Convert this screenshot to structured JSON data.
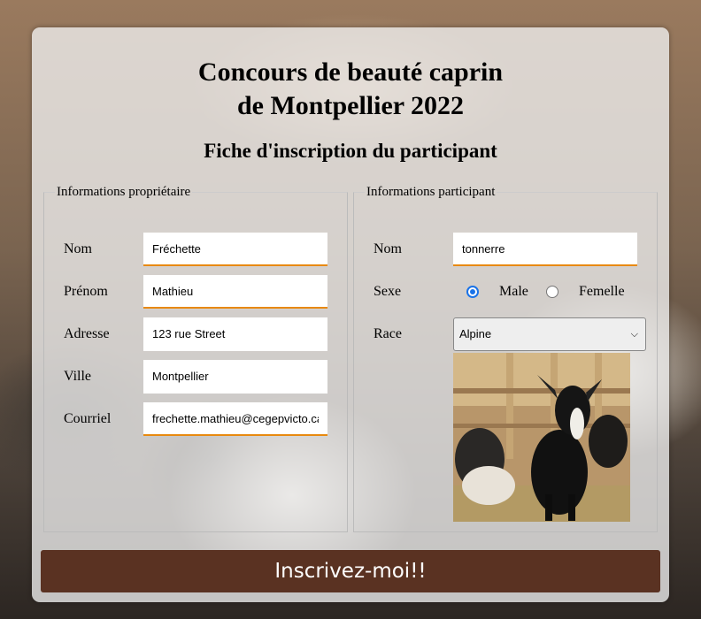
{
  "header": {
    "title_line1": "Concours de beauté caprin",
    "title_line2": "de Montpellier 2022",
    "subtitle": "Fiche d'inscription du participant"
  },
  "owner": {
    "legend": "Informations propriétaire",
    "fields": [
      {
        "label": "Nom",
        "value": "Fréchette"
      },
      {
        "label": "Prénom",
        "value": "Mathieu"
      },
      {
        "label": "Adresse",
        "value": "123 rue Street"
      },
      {
        "label": "Ville",
        "value": "Montpellier"
      },
      {
        "label": "Courriel",
        "value": "frechette.mathieu@cegepvicto.ca"
      }
    ]
  },
  "participant": {
    "legend": "Informations participant",
    "name_label": "Nom",
    "name_value": "tonnerre",
    "sex_label": "Sexe",
    "sex_options": [
      "Male",
      "Femelle"
    ],
    "sex_selected": "Male",
    "race_label": "Race",
    "race_value": "Alpine",
    "photo_icon": "goat-photo"
  },
  "submit_label": "Inscrivez-moi!!",
  "colors": {
    "accent": "#e8890f",
    "button": "#5a3222",
    "radio": "#1a73e8"
  }
}
